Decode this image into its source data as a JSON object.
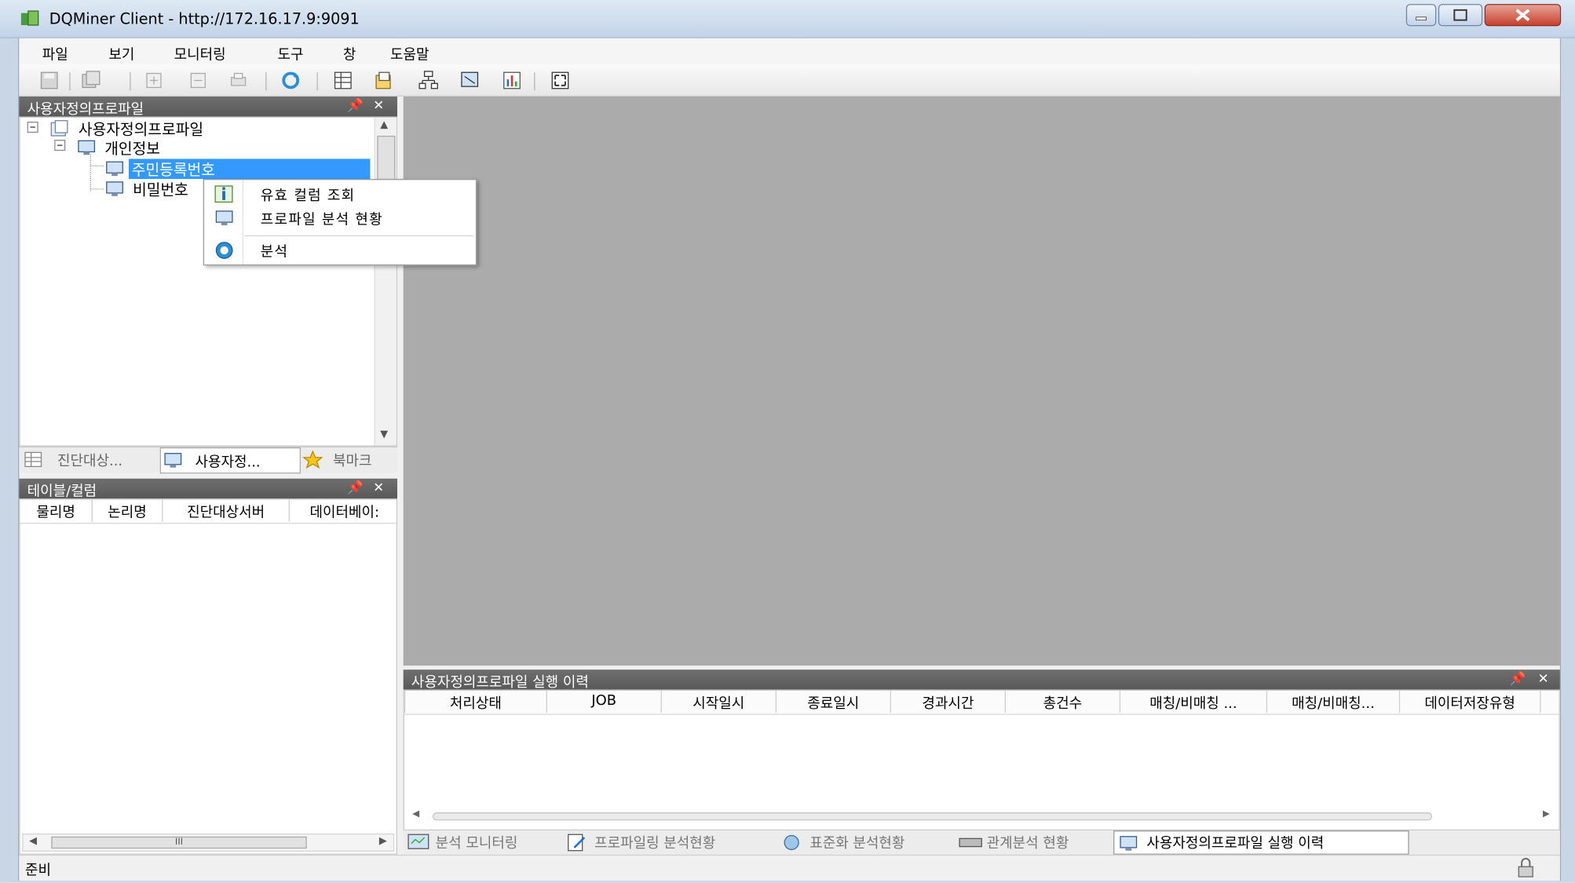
{
  "window": {
    "title": "DQMiner Client - http://172.16.17.9:9091"
  },
  "menu": [
    "파일",
    "보기",
    "모니터링",
    "도구",
    "창",
    "도움말"
  ],
  "profile_panel": {
    "title": "사용자정의프로파일",
    "tree": {
      "root": "사용자정의프로파일",
      "group": "개인정보",
      "items": [
        "주민등록번호",
        "비밀번호"
      ]
    }
  },
  "context_menu": {
    "items": [
      "유효 컬럼 조회",
      "프로파일 분석 현황",
      "분석"
    ]
  },
  "left_tabs": [
    "진단대상...",
    "사용자정...",
    "북마크"
  ],
  "table_panel": {
    "title": "테이블/컬럼",
    "columns": [
      "물리명",
      "논리명",
      "진단대상서버",
      "데이터베이:"
    ]
  },
  "history_panel": {
    "title": "사용자정의프로파일 실행 이력",
    "columns": [
      "처리상태",
      "JOB",
      "시작일시",
      "종료일시",
      "경과시간",
      "총건수",
      "매칭/비매칭 ...",
      "매칭/비매칭...",
      "데이터저장유형"
    ]
  },
  "bottom_tabs": [
    "분석 모니터링",
    "프로파일링 분석현황",
    "표준화 분석현황",
    "관계분석 현황",
    "사용자정의프로파일 실행 이력"
  ],
  "hscroll_thumb_label": "III",
  "status": {
    "text": "준비"
  },
  "icons": [
    "app-icon",
    "minimize-icon",
    "maximize-icon",
    "close-icon",
    "save-icon",
    "refresh-icon",
    "pin-icon",
    "panel-close-icon",
    "tree-collapse-icon",
    "folder-icon",
    "profile-icon",
    "info-icon",
    "analyze-icon",
    "star-icon",
    "lock-icon"
  ]
}
